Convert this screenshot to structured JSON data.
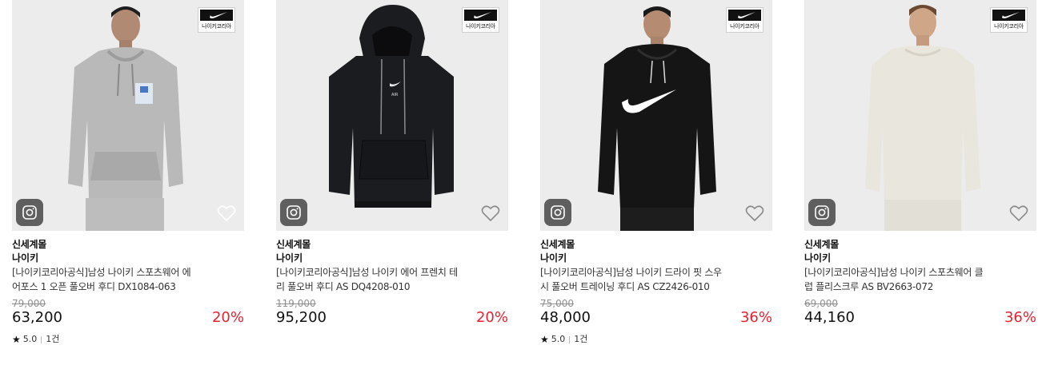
{
  "products": [
    {
      "mall": "신세계몰",
      "brand": "나이키",
      "title_line1": "[나이키코리아공식]남성 나이키 스포츠웨어 에",
      "title_line2": "어포스 1 오픈 풀오버 후디 DX1084-063",
      "original_price": "79,000",
      "price": "63,200",
      "discount": "20%",
      "rating": "5.0",
      "review_count": "1건",
      "badge_text": "나이키코리아",
      "garment_color": "#b9b9b9"
    },
    {
      "mall": "신세계몰",
      "brand": "나이키",
      "title_line1": "[나이키코리아공식]남성 나이키 에어 프렌치 테",
      "title_line2": "리 풀오버 후디 AS DQ4208-010",
      "original_price": "119,000",
      "price": "95,200",
      "discount": "20%",
      "badge_text": "나이키코리아",
      "garment_color": "#1b1c20"
    },
    {
      "mall": "신세계몰",
      "brand": "나이키",
      "title_line1": "[나이키코리아공식]남성 나이키 드라이 핏 스우",
      "title_line2": "시 풀오버 트레이닝 후디 AS CZ2426-010",
      "original_price": "75,000",
      "price": "48,000",
      "discount": "36%",
      "rating": "5.0",
      "review_count": "1건",
      "badge_text": "나이키코리아",
      "garment_color": "#151515"
    },
    {
      "mall": "신세계몰",
      "brand": "나이키",
      "title_line1": "[나이키코리아공식]남성 나이키 스포츠웨어 클",
      "title_line2": "럽 플리스크루 AS BV2663-072",
      "original_price": "69,000",
      "price": "44,160",
      "discount": "36%",
      "badge_text": "나이키코리아",
      "garment_color": "#e9e6dd"
    }
  ],
  "icons": {
    "instagram": "instagram-icon",
    "wishlist": "heart-icon",
    "star": "star-icon",
    "brand": "nike-swoosh-icon"
  },
  "colors": {
    "discount": "#e8212e",
    "original_price": "#8f8f8f"
  }
}
